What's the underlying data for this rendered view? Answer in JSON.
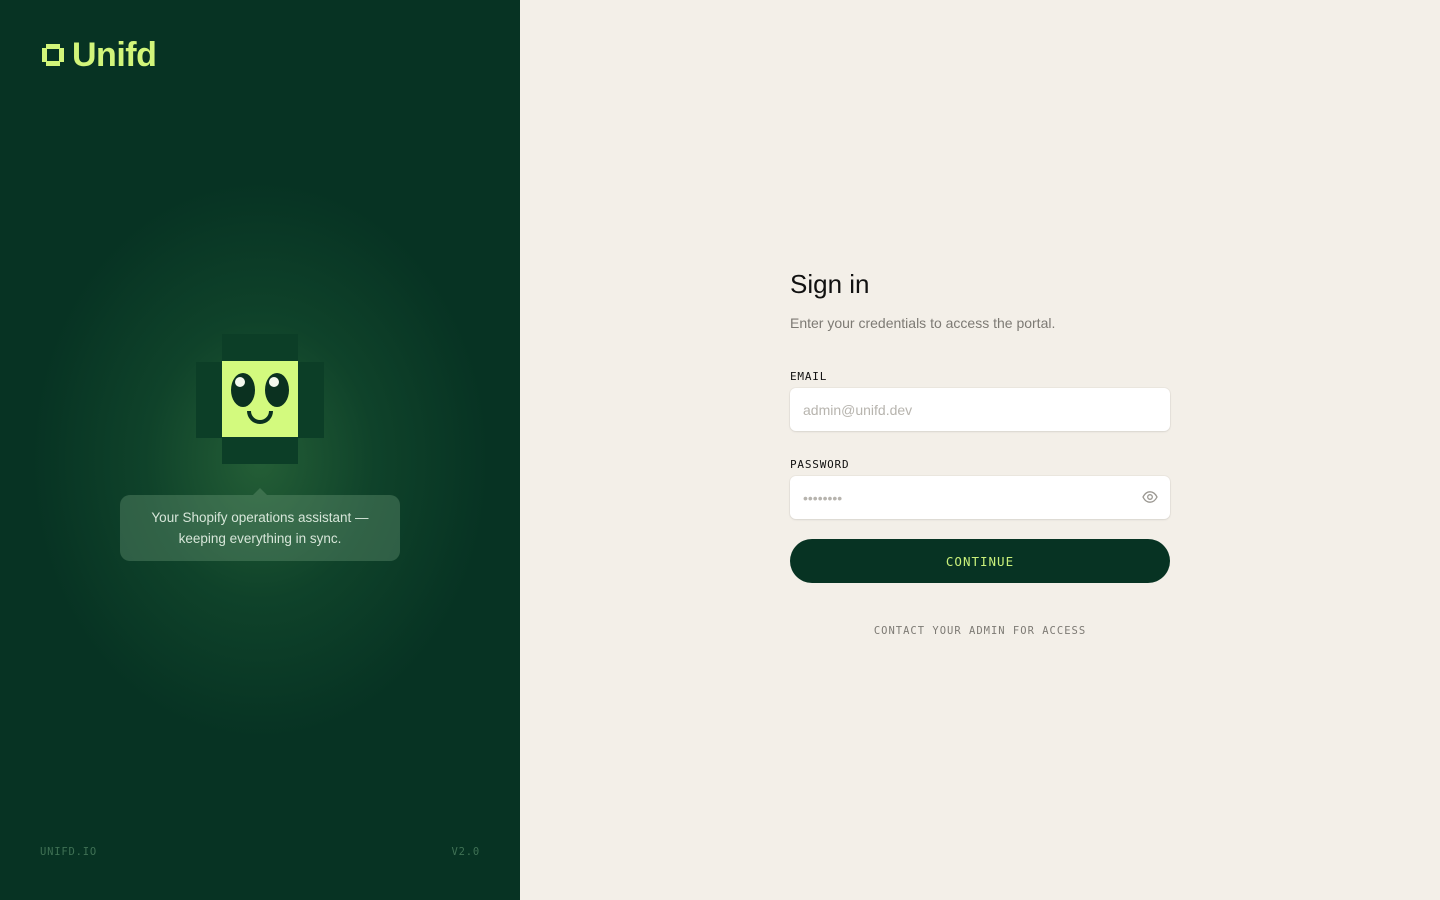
{
  "brand": {
    "name": "Unifd",
    "accent": "#d2f57a",
    "panel_bg": "#073323",
    "page_bg": "#f3efe8"
  },
  "left_panel": {
    "bubble_text": "Your Shopify operations assistant — keeping everything in sync.",
    "footer_left": "UNIFD.IO",
    "footer_right": "V2.0"
  },
  "form": {
    "title": "Sign in",
    "subtitle": "Enter your credentials to access the portal.",
    "email": {
      "label": "EMAIL",
      "placeholder": "admin@unifd.dev",
      "value": ""
    },
    "password": {
      "label": "PASSWORD",
      "placeholder": "••••••••",
      "value": "",
      "toggle_icon": "eye-icon"
    },
    "submit_label": "CONTINUE",
    "contact_text": "CONTACT YOUR ADMIN FOR ACCESS"
  }
}
